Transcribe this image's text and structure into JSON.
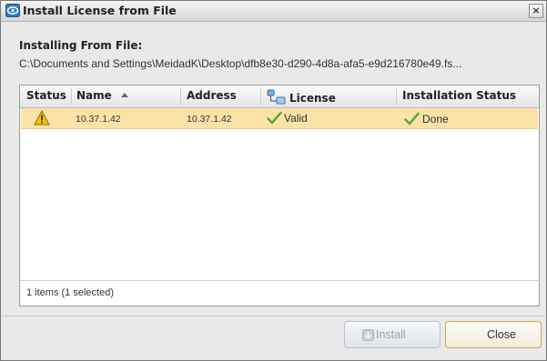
{
  "window": {
    "title": "Install License from File",
    "close_glyph": "×",
    "icon": "app-logo-icon"
  },
  "source": {
    "label": "Installing From File:",
    "path": "C:\\Documents and Settings\\MeidadK\\Desktop\\dfb8e30-d290-4d8a-afa5-e9d216780e49.fs..."
  },
  "table": {
    "columns": {
      "status": "Status",
      "name": "Name",
      "address": "Address",
      "license": "License",
      "installation_status": "Installation Status"
    },
    "sort_column": "name",
    "rows": [
      {
        "status_icon": "warning-icon",
        "name": "10.37.1.42",
        "address": "10.37.1.42",
        "license": "Valid",
        "installation_status": "Done",
        "selected": true
      }
    ],
    "footer": "1 items (1 selected)"
  },
  "buttons": {
    "install": "Install",
    "close": "Close"
  },
  "colors": {
    "selected_row": "#fbe2a7",
    "check_green": "#5aa33a",
    "warning": "#f2c400",
    "close_border": "#d8a34a"
  }
}
